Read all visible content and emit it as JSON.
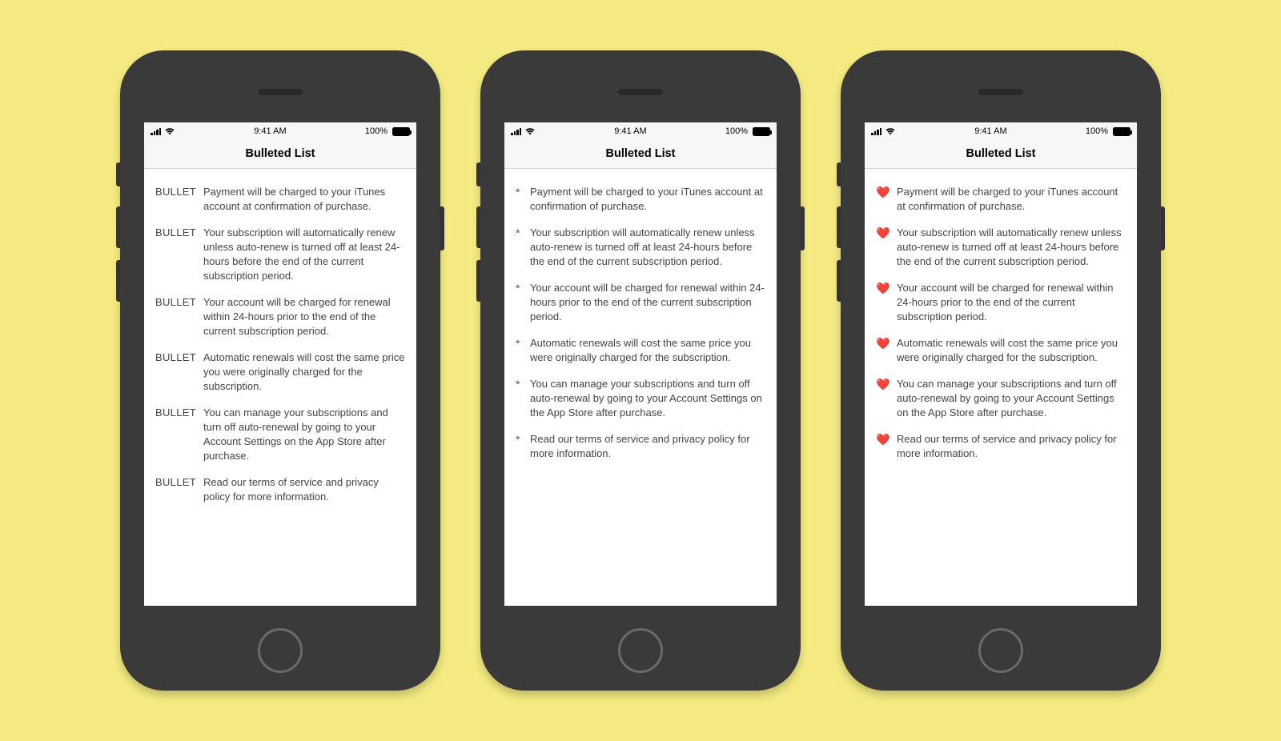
{
  "status": {
    "time": "9:41 AM",
    "battery_pct": "100%"
  },
  "nav_title": "Bulleted List",
  "bullets": {
    "word": "BULLET",
    "asterisk": "*",
    "heart": "❤️"
  },
  "items": [
    "Payment will be charged to your iTunes account at confirmation of purchase.",
    "Your subscription will automatically renew unless auto-renew is turned off at least 24-hours before the end of the current subscription period.",
    "Your account will be charged for renewal within 24-hours prior to the end of the current subscription period.",
    "Automatic renewals will cost the same price you were originally charged for the subscription.",
    "You can manage your subscriptions and turn off auto-renewal by going to your Account Settings on the App Store after purchase.",
    "Read our terms of service and privacy policy for more information."
  ],
  "phones": [
    {
      "bullet_style": "word"
    },
    {
      "bullet_style": "asterisk"
    },
    {
      "bullet_style": "heart"
    }
  ]
}
